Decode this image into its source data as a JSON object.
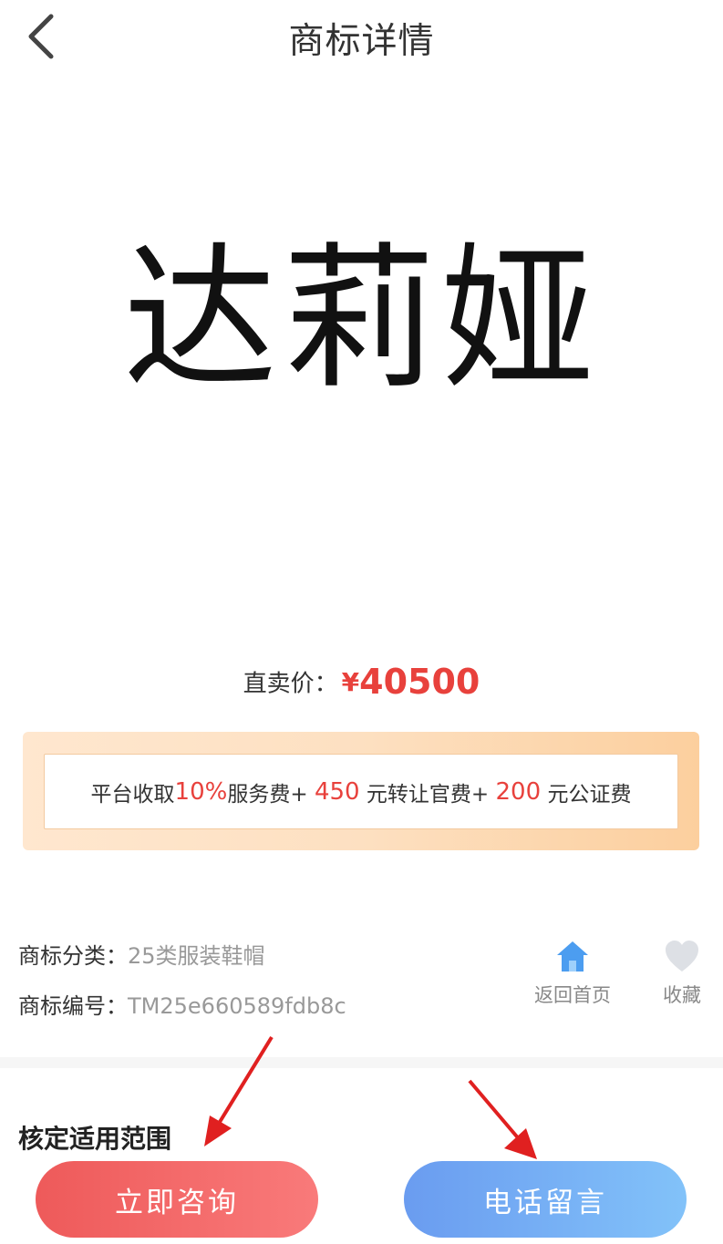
{
  "header": {
    "title": "商标详情",
    "back_icon": "chevron-left-icon"
  },
  "trademark": {
    "logo_text": "达莉娅"
  },
  "price": {
    "label": "直卖价：",
    "currency": "¥",
    "value": "40500",
    "accent_color": "#e8413c"
  },
  "fees": {
    "prefix": "平台收取",
    "service_rate": "10%",
    "service_suffix": "服务费+",
    "transfer_fee": "450",
    "transfer_suffix": "元转让官费+",
    "notary_fee": "200",
    "notary_suffix": "元公证费"
  },
  "info": {
    "category_label": "商标分类：",
    "category_value": "25类服装鞋帽",
    "number_label": "商标编号：",
    "number_value": "TM25e660589fdb8c"
  },
  "actions": {
    "home_label": "返回首页",
    "home_icon": "home-icon",
    "favorite_label": "收藏",
    "favorite_icon": "heart-icon"
  },
  "section": {
    "title": "核定适用范围"
  },
  "buttons": {
    "consult_label": "立即咨询",
    "phone_label": "电话留言"
  }
}
